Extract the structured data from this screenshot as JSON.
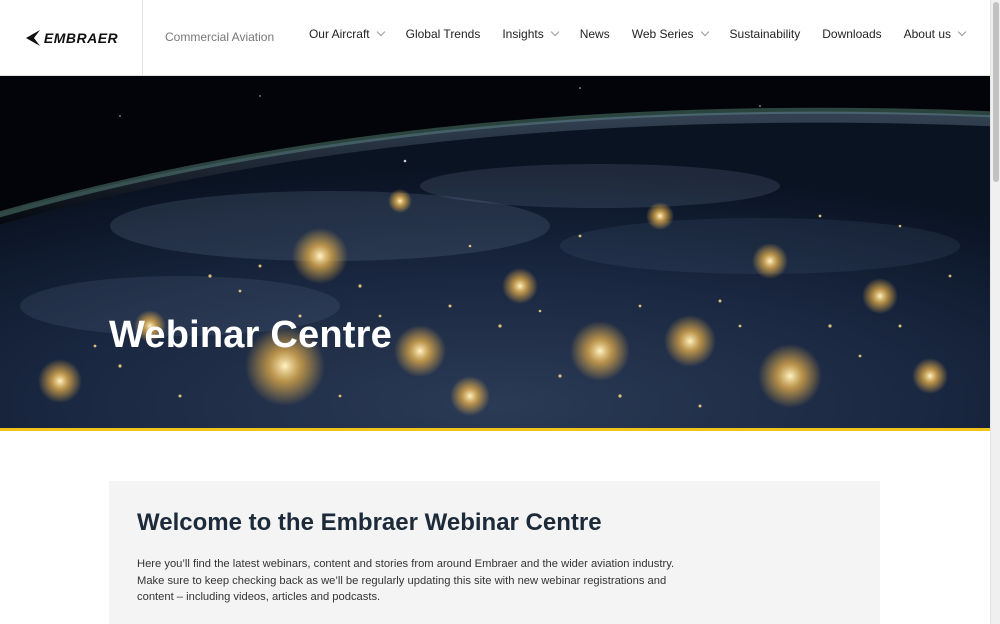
{
  "brand": {
    "logo_text": "EMBRAER",
    "division": "Commercial Aviation"
  },
  "nav": {
    "items": [
      {
        "label": "Our Aircraft",
        "dropdown": true
      },
      {
        "label": "Global Trends",
        "dropdown": false
      },
      {
        "label": "Insights",
        "dropdown": true
      },
      {
        "label": "News",
        "dropdown": false
      },
      {
        "label": "Web Series",
        "dropdown": true
      },
      {
        "label": "Sustainability",
        "dropdown": false
      },
      {
        "label": "Downloads",
        "dropdown": false
      },
      {
        "label": "About us",
        "dropdown": true
      }
    ]
  },
  "hero": {
    "title": "Webinar Centre",
    "image": "earth-at-night-from-space",
    "accent_color": "#f0c419"
  },
  "welcome": {
    "title": "Welcome to the Embraer Webinar Centre",
    "body": "Here you’ll find the latest webinars, content and stories from around Embraer and the wider aviation industry. Make sure to keep checking back as we’ll be regularly updating this site with new webinar registrations and content – including videos, articles and podcasts."
  }
}
